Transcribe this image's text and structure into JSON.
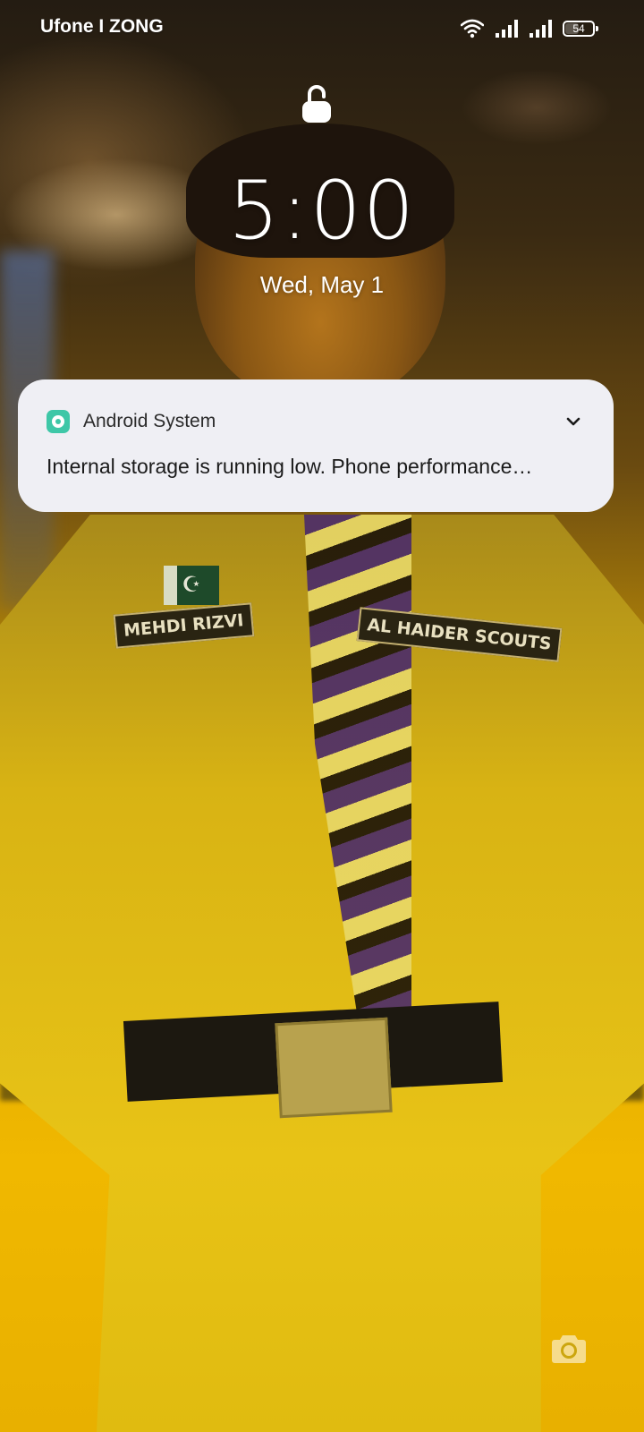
{
  "status_bar": {
    "carrier": "Ufone I ZONG",
    "battery_level": "54",
    "battery_fraction": 0.54,
    "icons": [
      "wifi-icon",
      "signal-icon",
      "signal-icon",
      "battery-icon"
    ]
  },
  "lockscreen": {
    "lock_icon": "lock-open-icon",
    "time": "5:00",
    "date": "Wed, May 1",
    "camera_icon": "camera-icon"
  },
  "wallpaper": {
    "name_tag_left": "MEHDI RIZVI",
    "name_tag_right": "AL HAIDER SCOUTS"
  },
  "notification": {
    "app_name": "Android System",
    "text": "Internal storage is running low. Phone performance…",
    "accent_color": "#3ec7a7"
  }
}
